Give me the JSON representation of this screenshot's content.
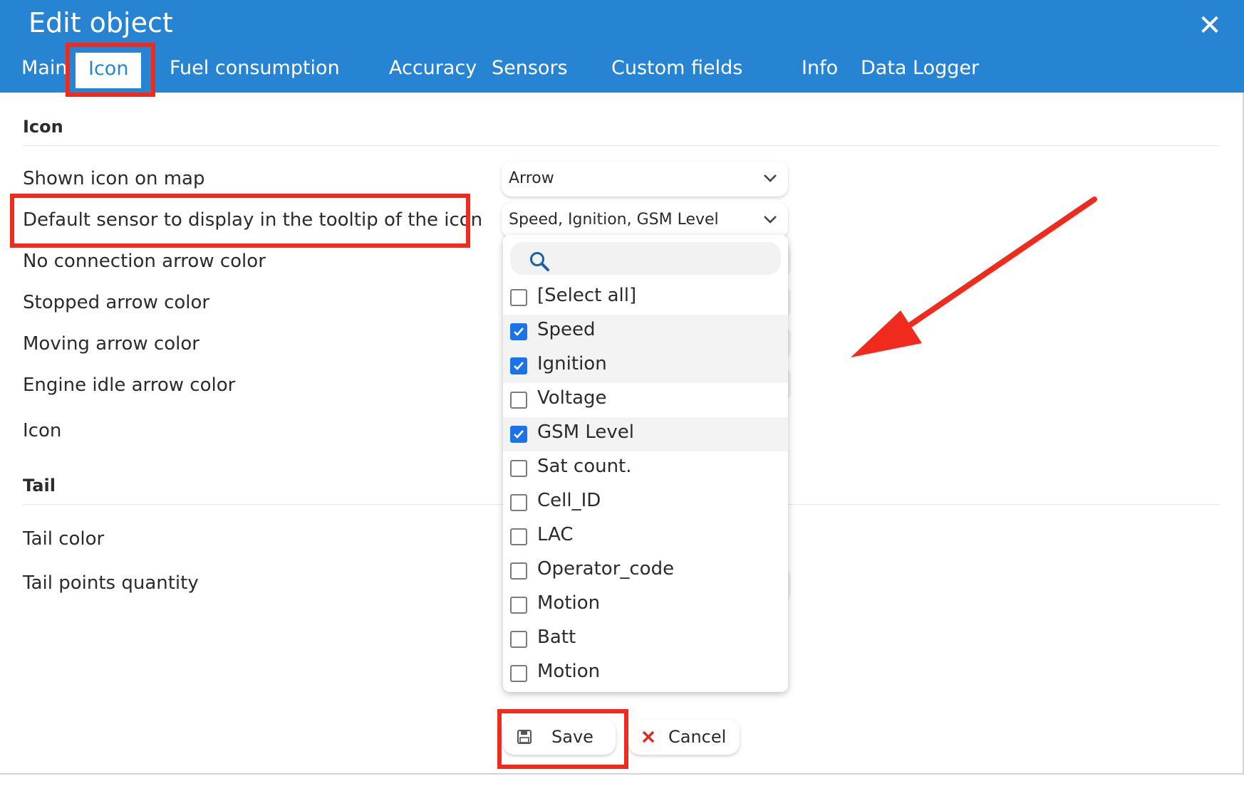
{
  "dialog": {
    "title": "Edit object",
    "close_icon": "close-icon"
  },
  "tabs": [
    {
      "label": "Main"
    },
    {
      "label": "Icon"
    },
    {
      "label": "Fuel consumption"
    },
    {
      "label": "Accuracy"
    },
    {
      "label": "Sensors"
    },
    {
      "label": "Custom fields"
    },
    {
      "label": "Info"
    },
    {
      "label": "Data Logger"
    }
  ],
  "active_tab": "Icon",
  "icon_section": {
    "title": "Icon",
    "fields": {
      "shown_icon": {
        "label": "Shown icon on map",
        "value": "Arrow"
      },
      "default_sensor": {
        "label": "Default sensor to display in the tooltip of the icon",
        "value": "Speed, Ignition, GSM Level"
      },
      "no_connection": {
        "label": "No connection arrow color"
      },
      "stopped": {
        "label": "Stopped arrow color"
      },
      "moving": {
        "label": "Moving arrow color"
      },
      "engine_idle": {
        "label": "Engine idle arrow color"
      },
      "icon": {
        "label": "Icon"
      }
    }
  },
  "tail_section": {
    "title": "Tail",
    "fields": {
      "tail_color": {
        "label": "Tail color"
      },
      "tail_points": {
        "label": "Tail points quantity"
      }
    }
  },
  "dropdown": {
    "search_icon": "search-icon",
    "search_value": "",
    "options": [
      {
        "label": "[Select all]",
        "checked": false
      },
      {
        "label": "Speed",
        "checked": true
      },
      {
        "label": "Ignition",
        "checked": true
      },
      {
        "label": "Voltage",
        "checked": false
      },
      {
        "label": "GSM Level",
        "checked": true
      },
      {
        "label": "Sat count.",
        "checked": false
      },
      {
        "label": "Cell_ID",
        "checked": false
      },
      {
        "label": "LAC",
        "checked": false
      },
      {
        "label": "Operator_code",
        "checked": false
      },
      {
        "label": "Motion",
        "checked": false
      },
      {
        "label": "Batt",
        "checked": false
      },
      {
        "label": "Motion",
        "checked": false
      }
    ]
  },
  "buttons": {
    "save": "Save",
    "cancel": "Cancel"
  },
  "colors": {
    "header": "#2784d3",
    "highlight": "#f02a1d",
    "checkbox": "#1a73e8"
  }
}
